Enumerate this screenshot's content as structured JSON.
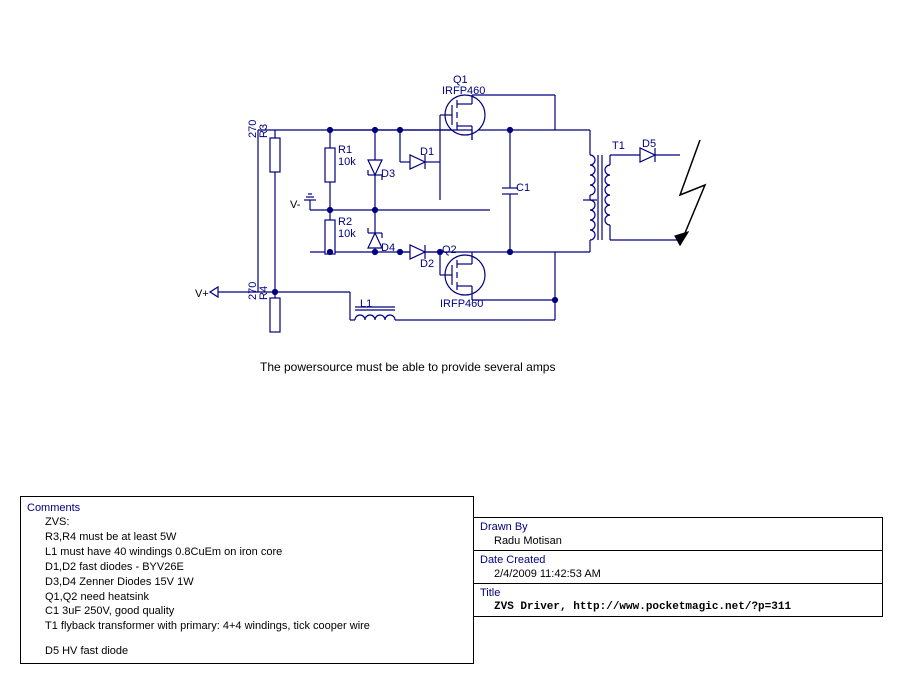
{
  "schematic": {
    "q1_ref": "Q1",
    "q1_part": "IRFP460",
    "q2_ref": "Q2",
    "q2_part": "IRFP460",
    "r1_ref": "R1",
    "r1_val": "10k",
    "r2_ref": "R2",
    "r2_val": "10k",
    "r3_ref": "R3",
    "r3_val": "270",
    "r4_ref": "R4",
    "r4_val": "270",
    "d1": "D1",
    "d2": "D2",
    "d3": "D3",
    "d4": "D4",
    "d5": "D5",
    "c1": "C1",
    "l1": "L1",
    "t1": "T1",
    "vminus": "V-",
    "vplus": "V+",
    "caption": "The powersource must be able to provide several amps"
  },
  "comments": {
    "header": "Comments",
    "line1": "ZVS:",
    "line2": "R3,R4 must be at least 5W",
    "line3": "L1 must  have 40 windings 0.8CuEm on iron core",
    "line4": "D1,D2 fast diodes - BYV26E",
    "line5": "D3,D4 Zenner Diodes 15V 1W",
    "line6": "Q1,Q2 need heatsink",
    "line7": "C1 3uF 250V, good quality",
    "line8": "T1 flyback transformer with  primary: 4+4 windings, tick cooper wire",
    "line9": "D5 HV fast diode"
  },
  "drawn_by": {
    "header": "Drawn By",
    "value": "Radu Motisan"
  },
  "date_created": {
    "header": "Date Created",
    "value": "2/4/2009 11:42:53 AM"
  },
  "title": {
    "header": "Title",
    "value": "ZVS Driver, http://www.pocketmagic.net/?p=311"
  }
}
